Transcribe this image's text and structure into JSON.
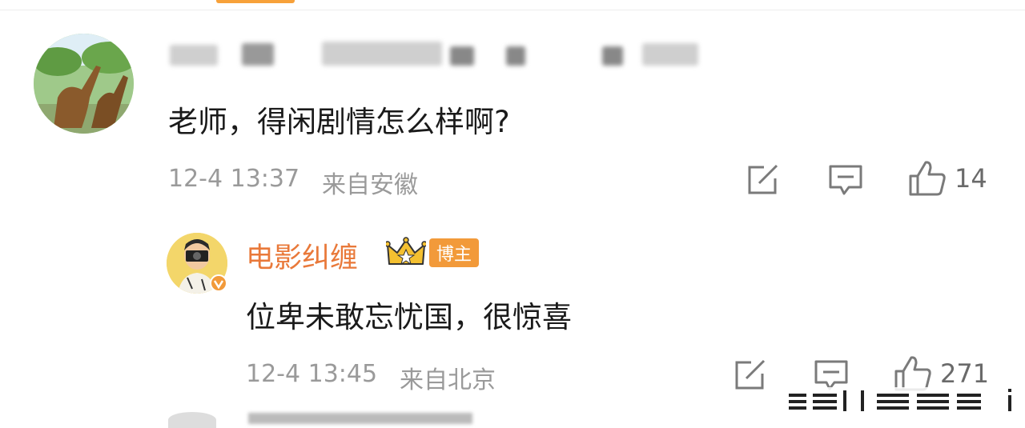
{
  "comment": {
    "text": "老师，得闲剧情怎么样啊?",
    "time": "12-4 13:37",
    "location": "来自安徽",
    "like_count": "14",
    "avatar_icon": "giraffe-photo-avatar"
  },
  "reply": {
    "author": "电影纠缠",
    "badge": "博主",
    "text": "位卑未敢忘忧国，很惊喜",
    "time": "12-4 13:45",
    "location": "来自北京",
    "like_count": "271",
    "avatar_icon": "photographer-cartoon-avatar"
  },
  "colors": {
    "author_name": "#e9793a",
    "badge_bg": "#f29a3a",
    "meta_text": "#9a9a9a",
    "accent": "#f7a13a"
  },
  "icons": {
    "share": "share-icon",
    "comment": "comment-icon",
    "like": "thumbs-up-icon",
    "crown": "crown-icon",
    "verified": "verified-v-icon"
  }
}
